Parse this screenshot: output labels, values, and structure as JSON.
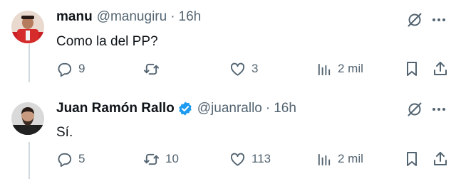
{
  "posts": [
    {
      "author_name": "manu",
      "author_handle": "@manugiru",
      "separator": "·",
      "time": "16h",
      "text": "Como la del PP?",
      "verified": false,
      "counts": {
        "replies": "9",
        "reposts": "",
        "likes": "3",
        "views": "2 mil"
      }
    },
    {
      "author_name": "Juan Ramón Rallo",
      "author_handle": "@juanrallo",
      "separator": "·",
      "time": "16h",
      "text": "Sí.",
      "verified": true,
      "counts": {
        "replies": "5",
        "reposts": "10",
        "likes": "113",
        "views": "2 mil"
      }
    }
  ],
  "icons": {
    "grok": "grok-icon",
    "more": "more-options-icon",
    "reply": "reply-icon",
    "repost": "repost-icon",
    "like": "heart-icon",
    "views": "views-icon",
    "bookmark": "bookmark-icon",
    "share": "share-icon",
    "verified": "verified-badge-icon"
  },
  "colors": {
    "text": "#0f1419",
    "secondary": "#536471",
    "verified": "#1d9bf0",
    "thread_line": "#cfd9de"
  }
}
